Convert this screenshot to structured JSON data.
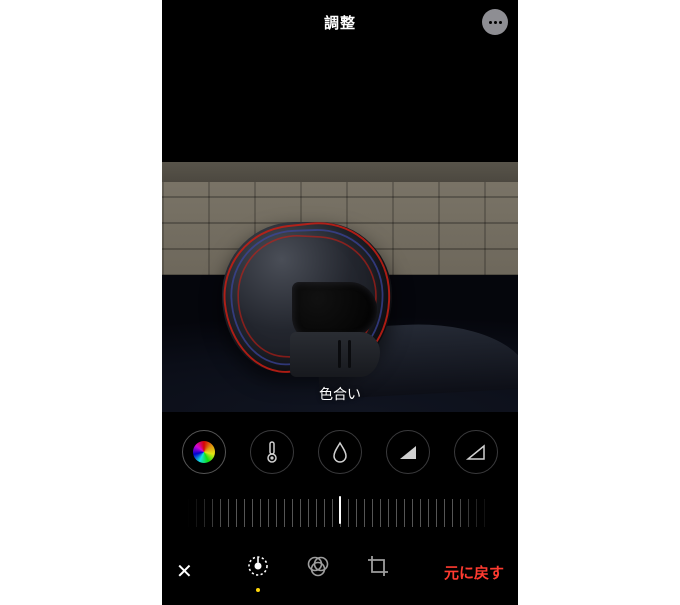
{
  "header": {
    "title": "調整"
  },
  "photo": {
    "adjustment_label": "色合い"
  },
  "adjustments": {
    "items": [
      {
        "name": "tint",
        "icon": "rainbow-circle-icon",
        "selected": true
      },
      {
        "name": "warmth",
        "icon": "thermometer-icon",
        "selected": false
      },
      {
        "name": "sharpness",
        "icon": "droplet-icon",
        "selected": false
      },
      {
        "name": "definition",
        "icon": "triangle-solid-icon",
        "selected": false
      },
      {
        "name": "vignette",
        "icon": "triangle-outline-icon",
        "selected": false
      }
    ]
  },
  "slider": {
    "value": 0,
    "min": -100,
    "max": 100
  },
  "bottom": {
    "cancel_glyph": "✕",
    "revert_label": "元に戻す",
    "tabs": {
      "adjust_selected": true
    }
  },
  "colors": {
    "accent_yellow": "#ffd60a",
    "destructive": "#ff3b30"
  }
}
